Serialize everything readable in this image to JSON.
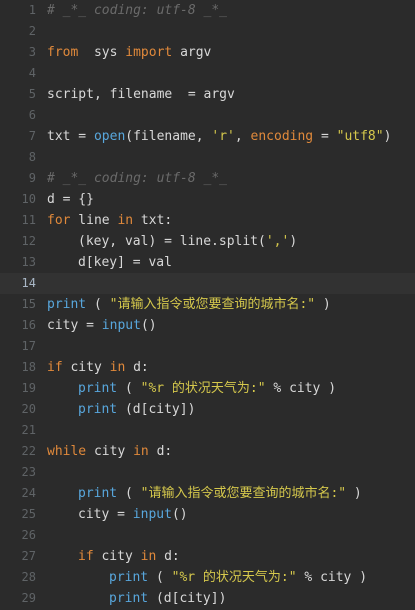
{
  "editor": {
    "current_line": 14,
    "lines": [
      {
        "n": "1",
        "t": [
          [
            "cm",
            "# _*_ coding: utf-8 _*_"
          ]
        ]
      },
      {
        "n": "2",
        "t": []
      },
      {
        "n": "3",
        "t": [
          [
            "kw",
            "from"
          ],
          [
            "",
            "  sys "
          ],
          [
            "kw",
            "import"
          ],
          [
            "",
            " argv"
          ]
        ]
      },
      {
        "n": "4",
        "t": []
      },
      {
        "n": "5",
        "t": [
          [
            "",
            "script, filename  = argv"
          ]
        ]
      },
      {
        "n": "6",
        "t": []
      },
      {
        "n": "7",
        "t": [
          [
            "",
            "txt = "
          ],
          [
            "fn",
            "open"
          ],
          [
            "",
            "(filename, "
          ],
          [
            "str",
            "'r'"
          ],
          [
            "",
            ", "
          ],
          [
            "kw",
            "encoding"
          ],
          [
            "",
            " = "
          ],
          [
            "str",
            "\"utf8\""
          ],
          [
            "",
            ")"
          ]
        ]
      },
      {
        "n": "8",
        "t": []
      },
      {
        "n": "9",
        "t": [
          [
            "cm",
            "# _*_ coding: utf-8 _*_"
          ]
        ]
      },
      {
        "n": "10",
        "t": [
          [
            "",
            "d = {}"
          ]
        ]
      },
      {
        "n": "11",
        "t": [
          [
            "kw",
            "for"
          ],
          [
            "",
            " line "
          ],
          [
            "kw",
            "in"
          ],
          [
            "",
            " txt:"
          ]
        ]
      },
      {
        "n": "12",
        "i": 1,
        "t": [
          [
            "",
            "(key, val) = line.split("
          ],
          [
            "str",
            "','"
          ],
          [
            "",
            ")"
          ]
        ]
      },
      {
        "n": "13",
        "i": 1,
        "t": [
          [
            "",
            "d[key] = val"
          ]
        ]
      },
      {
        "n": "14",
        "t": []
      },
      {
        "n": "15",
        "t": [
          [
            "fn",
            "print"
          ],
          [
            "",
            " ( "
          ],
          [
            "str",
            "\"请输入指令或您要查询的城市名:\""
          ],
          [
            "",
            " )"
          ]
        ]
      },
      {
        "n": "16",
        "t": [
          [
            "",
            "city = "
          ],
          [
            "fn",
            "input"
          ],
          [
            "",
            "()"
          ]
        ]
      },
      {
        "n": "17",
        "t": []
      },
      {
        "n": "18",
        "t": [
          [
            "kw",
            "if"
          ],
          [
            "",
            " city "
          ],
          [
            "kw",
            "in"
          ],
          [
            "",
            " d:"
          ]
        ]
      },
      {
        "n": "19",
        "i": 1,
        "t": [
          [
            "fn",
            "print"
          ],
          [
            "",
            " ( "
          ],
          [
            "str",
            "\"%r 的状况天气为:\""
          ],
          [
            "",
            " % city )"
          ]
        ]
      },
      {
        "n": "20",
        "i": 1,
        "t": [
          [
            "fn",
            "print"
          ],
          [
            "",
            " (d[city])"
          ]
        ]
      },
      {
        "n": "21",
        "t": []
      },
      {
        "n": "22",
        "t": [
          [
            "kw",
            "while"
          ],
          [
            "",
            " city "
          ],
          [
            "kw",
            "in"
          ],
          [
            "",
            " d:"
          ]
        ]
      },
      {
        "n": "23",
        "t": []
      },
      {
        "n": "24",
        "i": 1,
        "t": [
          [
            "fn",
            "print"
          ],
          [
            "",
            " ( "
          ],
          [
            "str",
            "\"请输入指令或您要查询的城市名:\""
          ],
          [
            "",
            " )"
          ]
        ]
      },
      {
        "n": "25",
        "i": 1,
        "t": [
          [
            "",
            "city = "
          ],
          [
            "fn",
            "input"
          ],
          [
            "",
            "()"
          ]
        ]
      },
      {
        "n": "26",
        "t": []
      },
      {
        "n": "27",
        "i": 1,
        "t": [
          [
            "kw",
            "if"
          ],
          [
            "",
            " city "
          ],
          [
            "kw",
            "in"
          ],
          [
            "",
            " d:"
          ]
        ]
      },
      {
        "n": "28",
        "i": 2,
        "t": [
          [
            "fn",
            "print"
          ],
          [
            "",
            " ( "
          ],
          [
            "str",
            "\"%r 的状况天气为:\""
          ],
          [
            "",
            " % city )"
          ]
        ]
      },
      {
        "n": "29",
        "i": 2,
        "t": [
          [
            "fn",
            "print"
          ],
          [
            "",
            " (d[city])"
          ]
        ]
      }
    ]
  }
}
